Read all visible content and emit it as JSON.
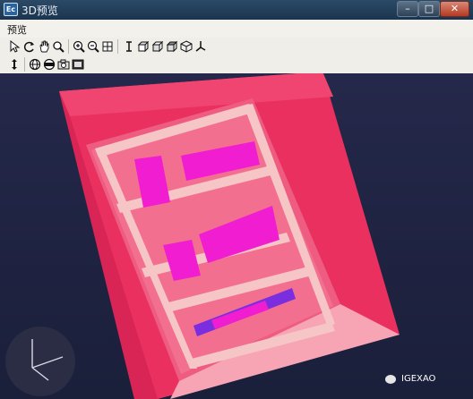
{
  "window": {
    "title": "3D预览",
    "app_icon_label": "Ec"
  },
  "titlebar_buttons": {
    "minimize": "–",
    "maximize": "□",
    "close": "✕"
  },
  "menu": {
    "items": [
      "预览"
    ]
  },
  "toolbar1": {
    "icons": [
      "select-arrow-icon",
      "rotate-icon",
      "pan-hand-icon",
      "zoom-icon",
      "zoom-in-icon",
      "zoom-out-icon",
      "zoom-fit-icon",
      "text-cursor-icon",
      "cube-front-icon",
      "cube-side-icon",
      "cube-top-icon",
      "cube-iso-icon",
      "axis-icon"
    ]
  },
  "toolbar2": {
    "icons": [
      "up-down-arrow-icon",
      "sphere-icon",
      "section-icon",
      "camera-icon",
      "film-icon"
    ]
  },
  "colors": {
    "cabinet_body": "#ea3766",
    "cabinet_inner": "#f0b6b9",
    "component_magenta": "#f01ed0",
    "component_violet": "#7a2ee0"
  },
  "watermark": {
    "text": "IGEXAO"
  }
}
